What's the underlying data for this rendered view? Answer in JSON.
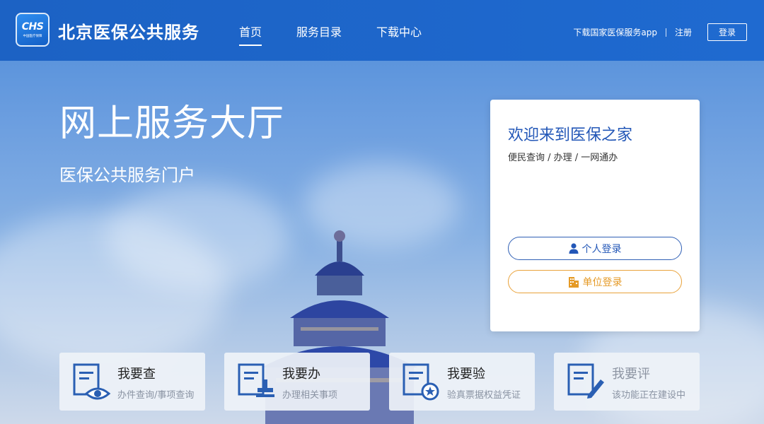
{
  "header": {
    "logo_text": "CHS",
    "logo_sub": "中国医疗保障",
    "site_title": "北京医保公共服务",
    "nav": [
      {
        "label": "首页",
        "active": true
      },
      {
        "label": "服务目录",
        "active": false
      },
      {
        "label": "下载中心",
        "active": false
      }
    ],
    "download_app": "下载国家医保服务app",
    "register": "注册",
    "login": "登录"
  },
  "hero": {
    "title": "网上服务大厅",
    "subtitle": "医保公共服务门户"
  },
  "login_card": {
    "title": "欢迎来到医保之家",
    "subtitle": "便民查询 / 办理 / 一网通办",
    "personal_login": "个人登录",
    "unit_login": "单位登录",
    "personal_icon": "person-icon",
    "unit_icon": "building-icon",
    "personal_color": "#2357b7",
    "unit_color": "#e59a26"
  },
  "services": [
    {
      "title": "我要查",
      "desc": "办件查询/事项查询",
      "icon": "document-eye-icon"
    },
    {
      "title": "我要办",
      "desc": "办理相关事项",
      "icon": "document-stamp-icon"
    },
    {
      "title": "我要验",
      "desc": "验真票据权益凭证",
      "icon": "document-star-icon"
    },
    {
      "title": "我要评",
      "desc": "该功能正在建设中",
      "icon": "document-pen-icon"
    }
  ]
}
